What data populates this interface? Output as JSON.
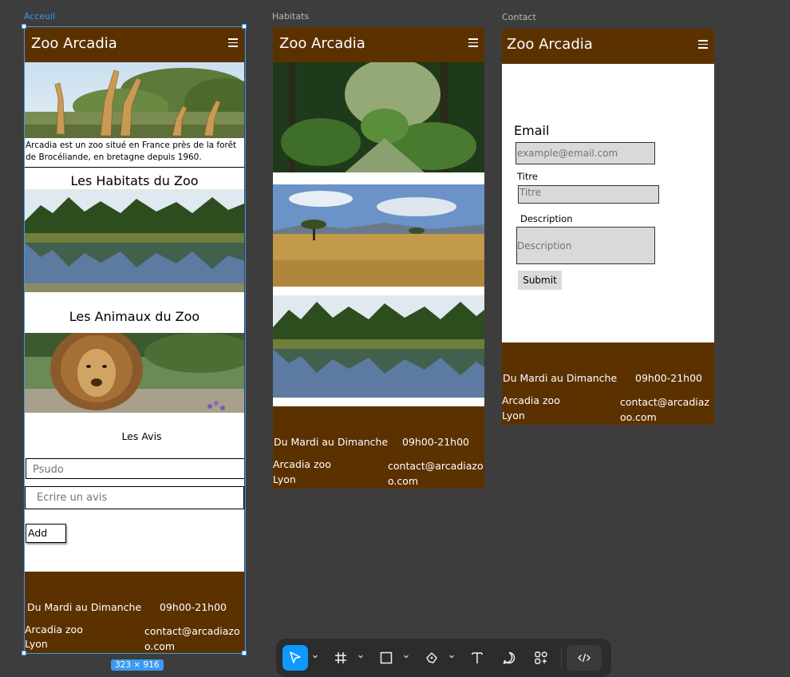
{
  "frames": {
    "accueil": {
      "label": "Acceuil",
      "brand": "Zoo Arcadia",
      "intro": "Arcadia est un zoo situé en France près de la forêt de Brocéliande, en bretagne depuis 1960.",
      "habitats_title": "Les Habitats du Zoo",
      "animals_title": "Les Animaux du Zoo",
      "reviews_title": "Les Avis",
      "pseudo_placeholder": "Psudo",
      "review_placeholder": "Ecrire un avis",
      "add_label": "Add",
      "size_badge": "323 × 916"
    },
    "habitats": {
      "label": "Habitats",
      "brand": "Zoo Arcadia"
    },
    "contact": {
      "label": "Contact",
      "brand": "Zoo Arcadia",
      "email_label": "Email",
      "email_placeholder": "example@email.com",
      "title_label": "Titre",
      "title_placeholder": "Titre",
      "description_label": "Description",
      "description_placeholder": "Description",
      "submit_label": "Submit"
    }
  },
  "footer": {
    "days": "Du Mardi au Dimanche",
    "hours": "09h00-21h00",
    "org": "Arcadia zoo",
    "city": "Lyon",
    "email": "contact@arcadiazoo.com"
  },
  "colors": {
    "brand_brown": "#5c3100",
    "canvas": "#3d3d3d",
    "selection": "#3b9bf0",
    "toolbar": "#2c2c2c"
  },
  "toolbar": {
    "tools": [
      "move-icon",
      "frame-icon",
      "rectangle-icon",
      "pen-icon",
      "text-icon",
      "comment-icon",
      "components-icon",
      "dev-mode-icon"
    ],
    "active_tool": "move-icon"
  }
}
